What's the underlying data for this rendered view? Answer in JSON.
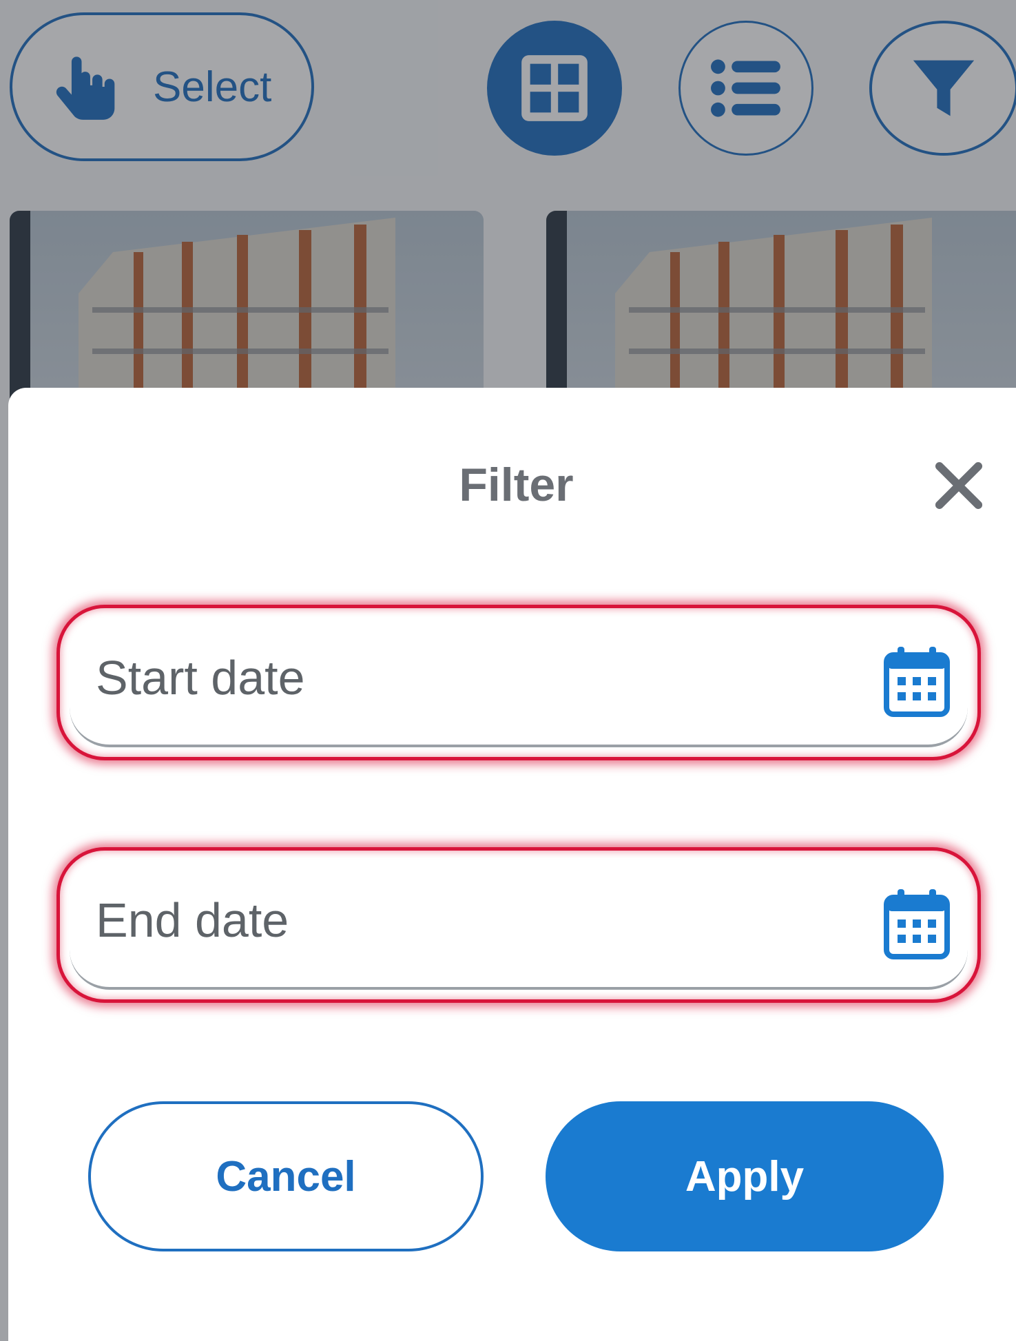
{
  "toolbar": {
    "select_label": "Select",
    "icons": [
      "hand-pointer-icon",
      "grid-view-icon",
      "list-view-icon",
      "filter-icon"
    ]
  },
  "filter_sheet": {
    "title": "Filter",
    "start_date": {
      "value": "",
      "placeholder": "Start date"
    },
    "end_date": {
      "value": "",
      "placeholder": "End date"
    },
    "cancel_label": "Cancel",
    "apply_label": "Apply"
  },
  "colors": {
    "primary": "#1f6fc0",
    "apply_button": "#1a7bd0",
    "highlight": "#d8143a",
    "title_text": "#6a6e74"
  }
}
